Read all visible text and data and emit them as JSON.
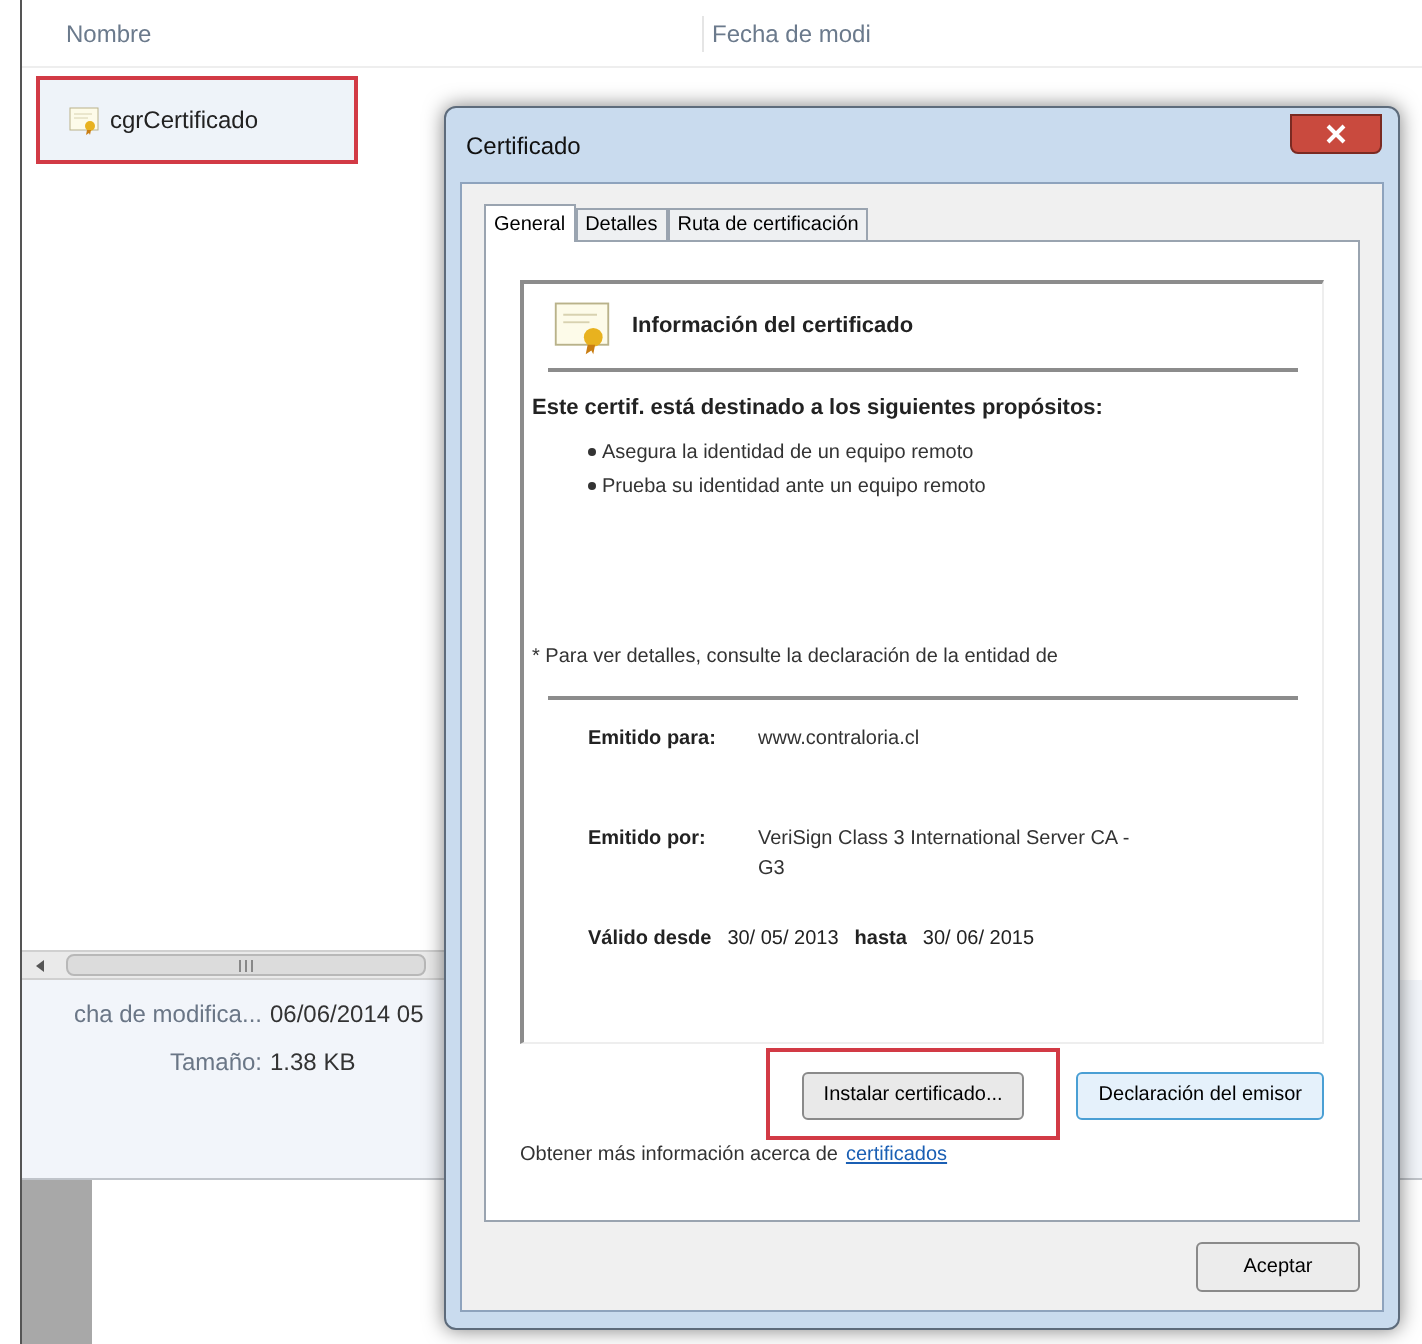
{
  "explorer": {
    "columns": [
      "Nombre",
      "Fecha de modi"
    ],
    "files": [
      {
        "name": "cgrCertificado",
        "highlighted": true
      }
    ],
    "details": [
      {
        "label": "cha de modifica...",
        "value": "06/06/2014 05"
      },
      {
        "label": "Tamaño:",
        "value": "1.38 KB"
      }
    ]
  },
  "dialog": {
    "title": "Certificado",
    "tabs": [
      {
        "label": "General",
        "selected": true
      },
      {
        "label": "Detalles",
        "selected": false
      },
      {
        "label": "Ruta de certificación",
        "selected": false
      }
    ],
    "heading": "Información del certificado",
    "purposes_title": "Este certif. está destinado a los siguientes propósitos:",
    "purposes": [
      "Asegura la identidad de un equipo remoto",
      "Prueba su identidad ante un equipo remoto"
    ],
    "note": "* Para ver detalles, consulte la declaración de la entidad de",
    "fields": [
      {
        "label": "Emitido para:",
        "value": "www.contraloria.cl"
      },
      {
        "label": "Emitido por:",
        "value": "VeriSign Class 3 International Server CA - G3"
      }
    ],
    "validity": {
      "from_label": "Válido desde",
      "from": "30/ 05/ 2013",
      "to_label": "hasta",
      "to": "30/ 06/ 2015"
    },
    "buttons": [
      {
        "label": "Instalar certificado...",
        "highlighted": true
      },
      {
        "label": "Declaración del emisor",
        "highlighted": false
      }
    ],
    "info_text": "Obtener más información acerca de",
    "info_link": "certificados",
    "ok_button": "Aceptar"
  }
}
